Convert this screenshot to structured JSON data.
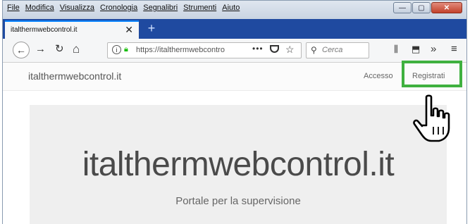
{
  "menu": [
    "File",
    "Modifica",
    "Visualizza",
    "Cronologia",
    "Segnalibri",
    "Strumenti",
    "Aiuto"
  ],
  "window_buttons": {
    "minimize": "—",
    "maximize": "▢",
    "close": "✕"
  },
  "tab": {
    "title": "italthermwebcontrol.it",
    "close": "✕",
    "new": "+"
  },
  "nav": {
    "back": "←",
    "forward": "→",
    "reload": "↻",
    "home": "⌂",
    "url": "https://italthermwebcontro",
    "url_more": "•••",
    "search_placeholder": "Cerca",
    "library": "⫼",
    "downloads": "⬒",
    "overflow": "»",
    "menu": "≡"
  },
  "site": {
    "brand": "italthermwebcontrol.it",
    "nav_access": "Accesso",
    "nav_register": "Registrati",
    "hero_title": "italthermwebcontrol.it",
    "hero_subtitle": "Portale per la supervisione"
  },
  "colors": {
    "highlight": "#3fb13f",
    "tabstrip": "#1f4aa0",
    "secure": "#12bc00"
  }
}
